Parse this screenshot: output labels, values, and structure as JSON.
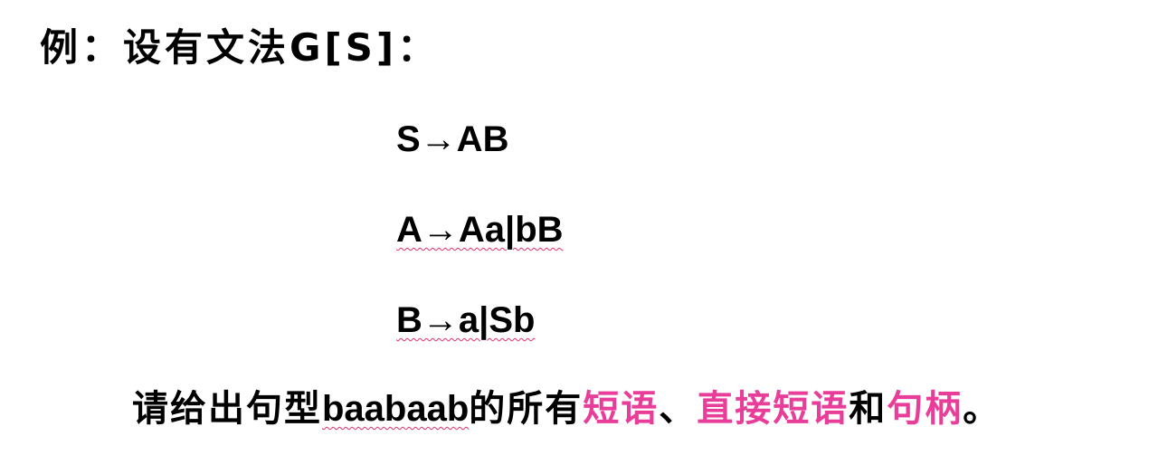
{
  "title": "例：设有文法G[S]：",
  "rules": [
    {
      "text": "S→AB"
    },
    {
      "text": "A→Aa|bB"
    },
    {
      "text": "B→a|Sb"
    }
  ],
  "question": {
    "prefix": "请给出句型",
    "sentence": "baabaab",
    "mid": "的所有",
    "term1": "短语",
    "sep": "、",
    "term2": "直接短语",
    "conj": "和",
    "term3": "句柄",
    "end": "。"
  },
  "colors": {
    "highlight": "#e83e9a",
    "spellcheck_underline": "#e0306a"
  }
}
